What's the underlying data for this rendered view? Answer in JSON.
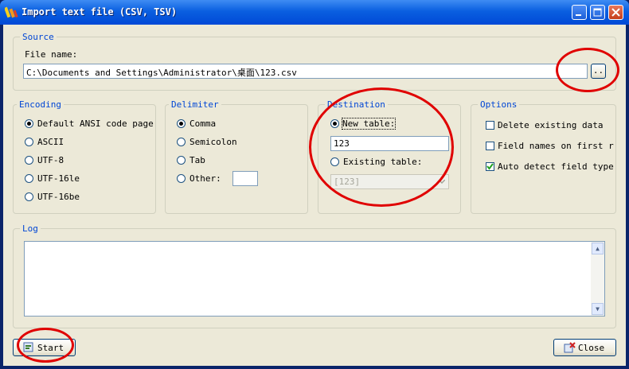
{
  "window": {
    "title": "Import text file (CSV, TSV)"
  },
  "source": {
    "legend": "Source",
    "file_label": "File name:",
    "file_value": "C:\\Documents and Settings\\Administrator\\桌面\\123.csv",
    "browse_label": ".."
  },
  "encoding": {
    "legend": "Encoding",
    "options": [
      "Default ANSI code page",
      "ASCII",
      "UTF-8",
      "UTF-16le",
      "UTF-16be"
    ],
    "selected": "Default ANSI code page"
  },
  "delimiter": {
    "legend": "Delimiter",
    "options": [
      "Comma",
      "Semicolon",
      "Tab",
      "Other:"
    ],
    "selected": "Comma",
    "other_value": ""
  },
  "destination": {
    "legend": "Destination",
    "new_table_label": "New table:",
    "new_table_value": "123",
    "existing_table_label": "Existing table:",
    "existing_table_value": "[123]",
    "selected": "New table:"
  },
  "options": {
    "legend": "Options",
    "items": [
      {
        "label": "Delete existing data",
        "checked": false
      },
      {
        "label": "Field names on first r",
        "checked": false
      },
      {
        "label": "Auto detect field type",
        "checked": true
      }
    ]
  },
  "log": {
    "legend": "Log",
    "content": ""
  },
  "buttons": {
    "start": "Start",
    "close": "Close"
  },
  "colors": {
    "titlebar": "#0a5fe0",
    "face": "#ece9d8",
    "legend_text": "#0046d5",
    "highlight_circle": "#e00000"
  }
}
